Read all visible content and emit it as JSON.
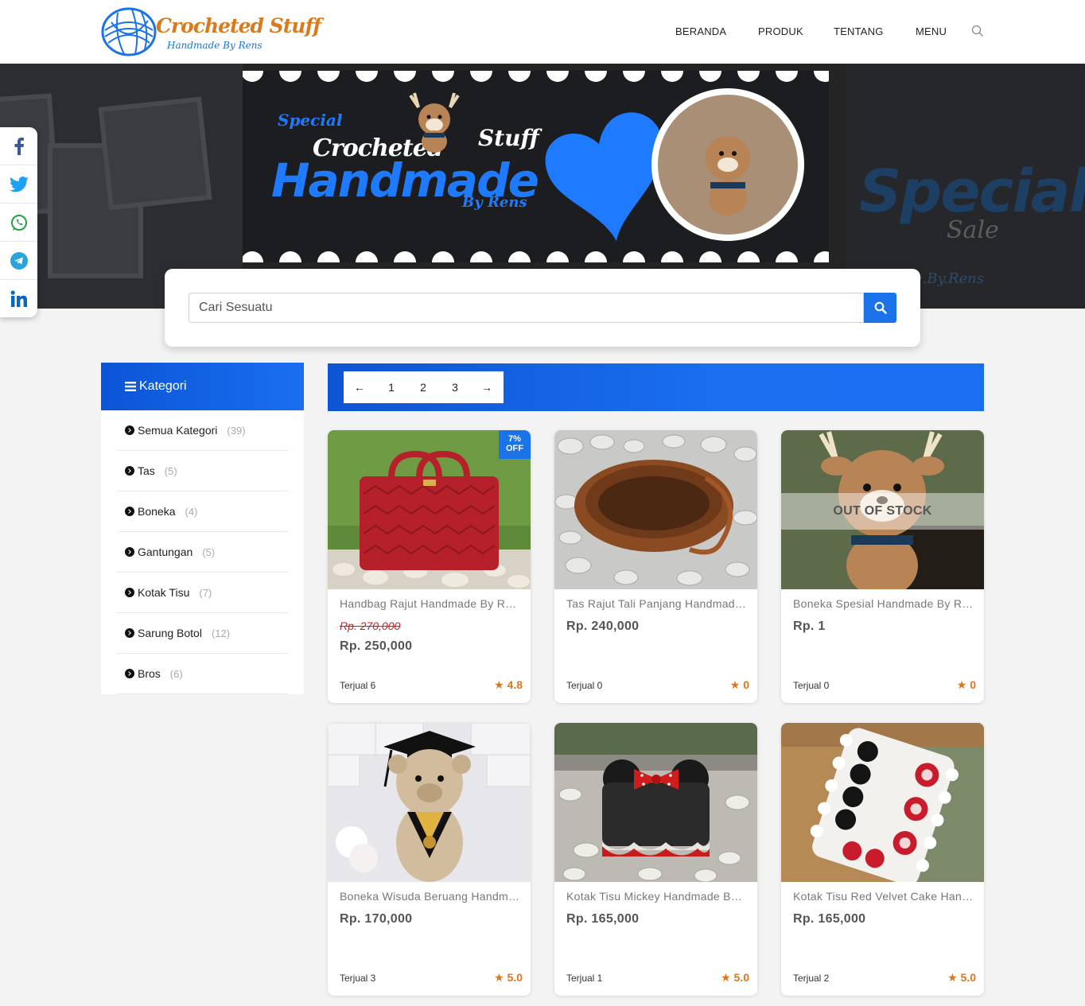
{
  "header": {
    "logo_title": "Crocheted Stuff",
    "logo_subtitle": "Handmade By Rens",
    "nav": [
      "BERANDA",
      "PRODUK",
      "TENTANG",
      "MENU"
    ],
    "search_icon": "search-icon"
  },
  "hero": {
    "banner_special": "Special",
    "banner_crocheted": "Crocheted",
    "banner_stuff": "Stuff",
    "banner_handmade": "Handmade",
    "banner_byrens": "By Rens",
    "sale_big": "Special",
    "sale_small": "Sale",
    "sale_signature": "Handmade.By.Rens"
  },
  "social": [
    "facebook-icon",
    "twitter-icon",
    "whatsapp-icon",
    "telegram-icon",
    "linkedin-icon"
  ],
  "search": {
    "placeholder": "Cari Sesuatu",
    "button_icon": "search-icon"
  },
  "categories": {
    "title": "Kategori",
    "items": [
      {
        "label": "Semua Kategori",
        "count": "(39)"
      },
      {
        "label": "Tas",
        "count": "(5)"
      },
      {
        "label": "Boneka",
        "count": "(4)"
      },
      {
        "label": "Gantungan",
        "count": "(5)"
      },
      {
        "label": "Kotak Tisu",
        "count": "(7)"
      },
      {
        "label": "Sarung Botol",
        "count": "(12)"
      },
      {
        "label": "Bros",
        "count": "(6)"
      }
    ]
  },
  "pagination": {
    "prev": "←",
    "pages": [
      "1",
      "2",
      "3"
    ],
    "next": "→"
  },
  "products": [
    {
      "title": "Handbag Rajut Handmade By Rens",
      "old_price": "Rp. 270,000",
      "price": "Rp. 250,000",
      "sold": "Terjual 6",
      "rating": "4.8",
      "badge_line1": "7%",
      "badge_line2": "OFF",
      "bg": "#b5202a"
    },
    {
      "title": "Tas Rajut Tali Panjang Handmade By Rens",
      "price": "Rp. 240,000",
      "sold": "Terjual 0",
      "rating": "0",
      "bg": "#9c5a2c"
    },
    {
      "title": "Boneka Spesial Handmade By Rens",
      "price": "Rp. 1",
      "sold": "Terjual 0",
      "rating": "0",
      "stock_label": "OUT OF STOCK",
      "bg": "#7a5a44"
    },
    {
      "title": "Boneka Wisuda Beruang Handmade By Rens",
      "price": "Rp. 170,000",
      "sold": "Terjual 3",
      "rating": "5.0",
      "bg": "#cbb69a"
    },
    {
      "title": "Kotak Tisu Mickey Handmade By Rens",
      "price": "Rp. 165,000",
      "sold": "Terjual 1",
      "rating": "5.0",
      "bg": "#2b2b2b"
    },
    {
      "title": "Kotak Tisu Red Velvet Cake Handmade By Rens",
      "price": "Rp. 165,000",
      "sold": "Terjual 2",
      "rating": "5.0",
      "bg": "#b58a55"
    }
  ],
  "colors": {
    "accent": "#1a73e8",
    "rating": "#e07516",
    "strike": "#cc1f1f"
  }
}
